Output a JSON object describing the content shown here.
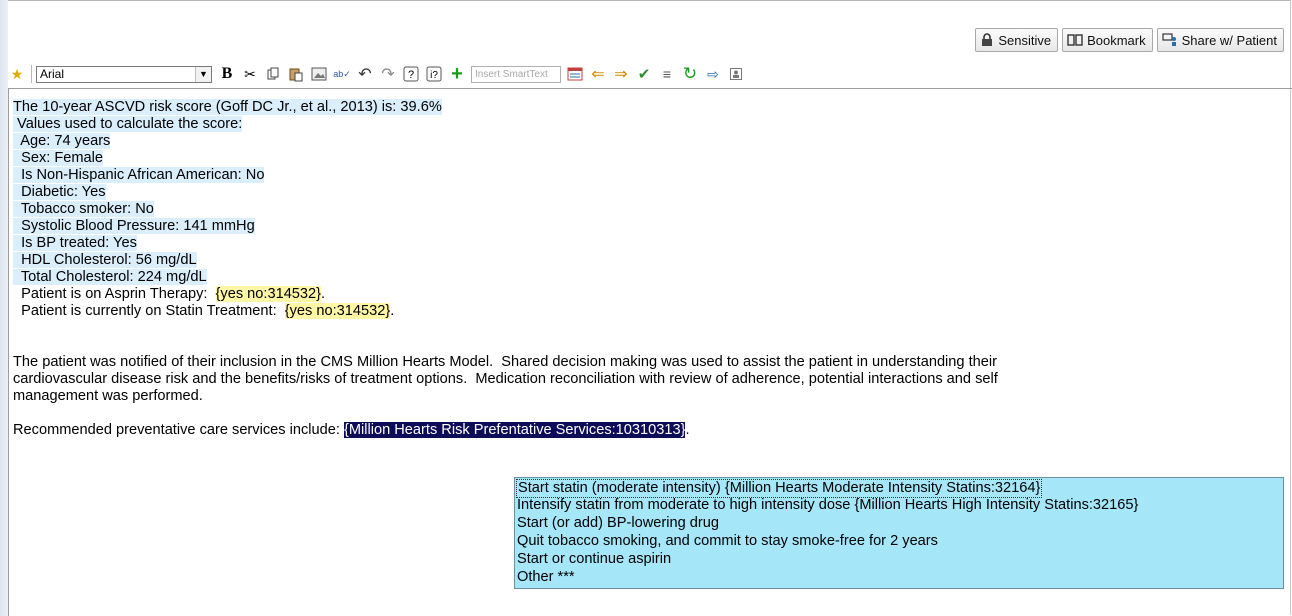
{
  "top_buttons": {
    "sensitive": "Sensitive",
    "bookmark": "Bookmark",
    "share": "Share w/ Patient"
  },
  "toolbar": {
    "font": "Arial",
    "smarttext_placeholder": "Insert SmartText",
    "bold_glyph": "B"
  },
  "note": {
    "risk_score": "The 10-year ASCVD risk score (Goff DC Jr., et al., 2013) is: 39.6%",
    "values_header": " Values used to calculate the score:",
    "values": [
      "  Age: 74 years",
      "  Sex: Female",
      "  Is Non-Hispanic African American: No",
      "  Diabetic: Yes",
      "  Tobacco smoker: No",
      "  Systolic Blood Pressure: 141 mmHg",
      "  Is BP treated: Yes",
      "  HDL Cholesterol: 56 mg/dL",
      "  Total Cholesterol: 224 mg/dL"
    ],
    "aspirin_label": "  Patient is on Asprin Therapy:  ",
    "aspirin_value": "{yes no:314532}",
    "statin_label": "  Patient is currently on Statin Treatment:  ",
    "statin_value": "{yes no:314532}",
    "period": ".",
    "paragraph_lines": [
      "The patient was notified of their inclusion in the CMS Million Hearts Model.  Shared decision making was used to assist the patient in understanding their",
      "cardiovascular disease risk and the benefits/risks of treatment options.  Medication reconciliation with review of adherence, potential interactions and self",
      "management was performed."
    ],
    "recommended_label": "Recommended preventative care services include: ",
    "recommended_value": "{Million Hearts Risk Prefentative Services:10310313}"
  },
  "dropdown_options": [
    "Start statin (moderate intensity) {Million Hearts Moderate Intensity Statins:32164}",
    "Intensify statin from moderate to high intensity dose {Million Hearts High Intensity Statins:32165}",
    "Start (or add) BP-lowering drug",
    "Quit tobacco smoking, and commit to stay smoke-free for 2 years",
    "Start or continue aspirin",
    "Other ***"
  ]
}
